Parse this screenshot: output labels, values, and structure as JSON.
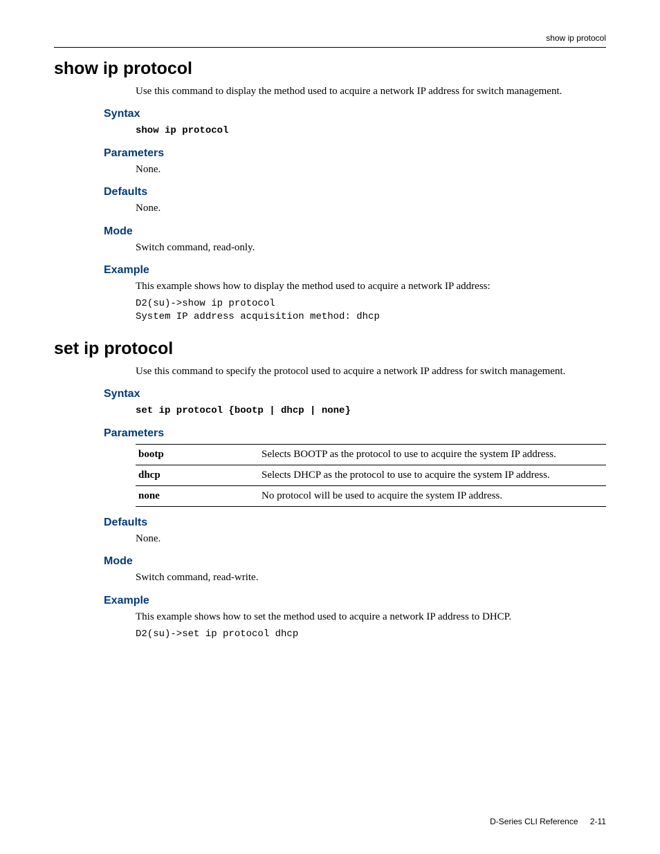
{
  "header": {
    "right": "show ip protocol"
  },
  "cmd1": {
    "title": "show ip protocol",
    "desc": "Use this command to display the method used to acquire a network IP address for switch management.",
    "syntax_head": "Syntax",
    "syntax_code": "show ip protocol",
    "params_head": "Parameters",
    "params_text": "None.",
    "defaults_head": "Defaults",
    "defaults_text": "None.",
    "mode_head": "Mode",
    "mode_text": "Switch command, read-only.",
    "example_head": "Example",
    "example_text": "This example shows how to display the method used to acquire a network IP address:",
    "example_code": "D2(su)->show ip protocol\nSystem IP address acquisition method: dhcp"
  },
  "cmd2": {
    "title": "set ip protocol",
    "desc": "Use this command to specify the protocol used to acquire a network IP address for switch management.",
    "syntax_head": "Syntax",
    "syntax_code": "set ip protocol {bootp | dhcp | none}",
    "params_head": "Parameters",
    "params": [
      {
        "key": "bootp",
        "desc": "Selects BOOTP as the protocol to use to acquire the system IP address."
      },
      {
        "key": "dhcp",
        "desc": "Selects DHCP as the protocol to use to acquire the system IP address."
      },
      {
        "key": "none",
        "desc": "No protocol will be used to acquire the system IP address."
      }
    ],
    "defaults_head": "Defaults",
    "defaults_text": "None.",
    "mode_head": "Mode",
    "mode_text": "Switch command, read-write.",
    "example_head": "Example",
    "example_text": "This example shows how to set the method used to acquire a network IP address to DHCP.",
    "example_code": "D2(su)->set ip protocol dhcp"
  },
  "footer": {
    "book": "D-Series CLI Reference",
    "page": "2-11"
  }
}
